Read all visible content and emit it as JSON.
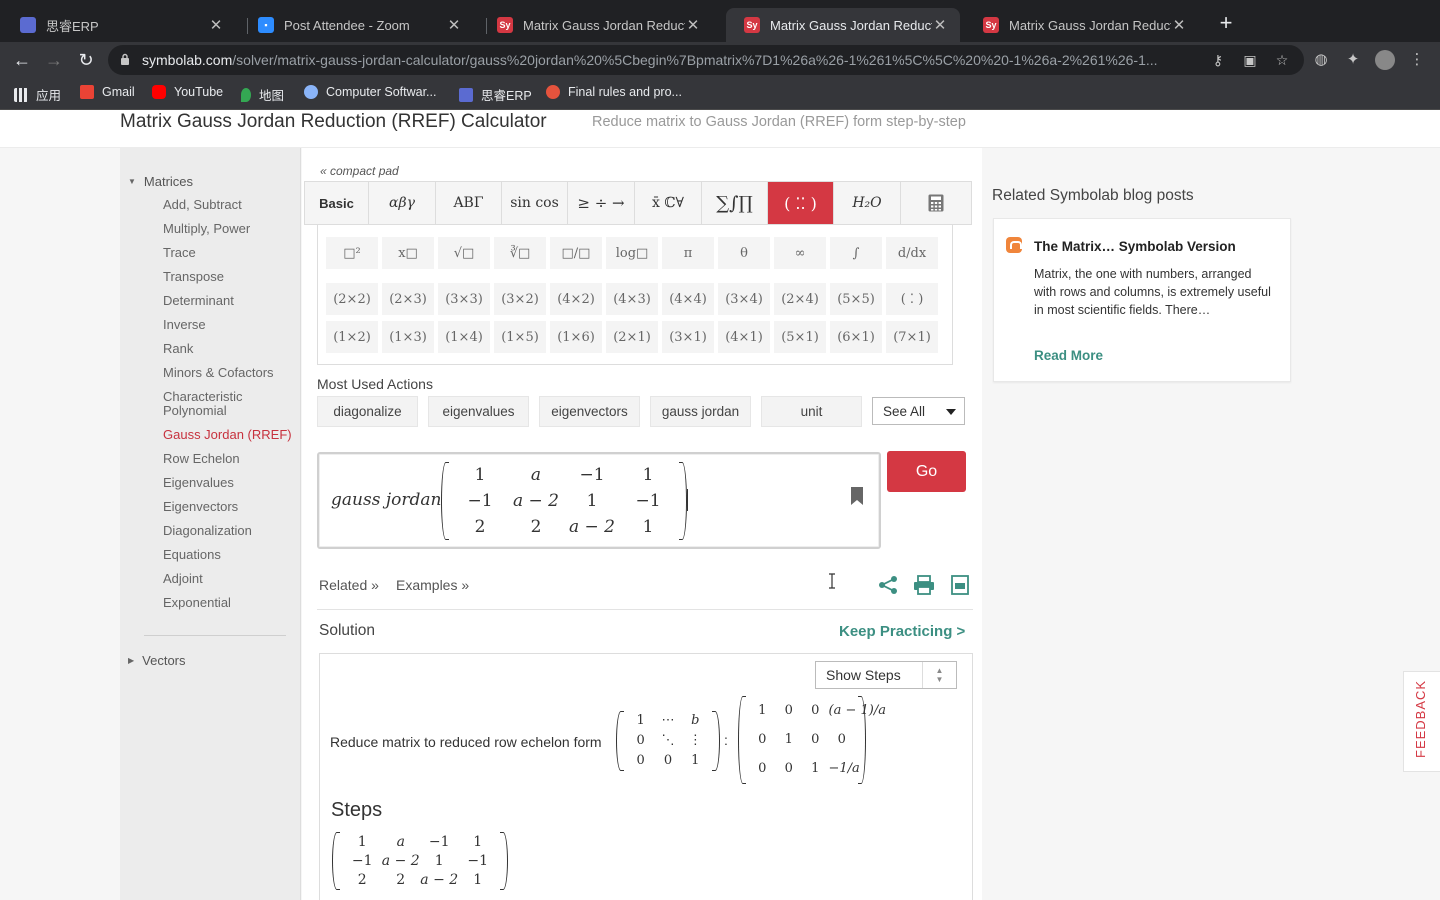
{
  "browser": {
    "tabs": [
      {
        "title": "思睿ERP",
        "favicon_color": "#5b6bd1"
      },
      {
        "title": "Post Attendee - Zoom",
        "favicon_color": "#2d8cff"
      },
      {
        "title": "Matrix Gauss Jordan Reduction",
        "favicon_color": "#d43843",
        "favicon_text": "Sy"
      },
      {
        "title": "Matrix Gauss Jordan Reduction",
        "favicon_color": "#d43843",
        "favicon_text": "Sy"
      },
      {
        "title": "Matrix Gauss Jordan Reduction",
        "favicon_color": "#d43843",
        "favicon_text": "Sy"
      }
    ],
    "active_tab_index": 3,
    "url_host": "symbolab.com",
    "url_path": "/solver/matrix-gauss-jordan-calculator/gauss%20jordan%20%5Cbegin%7Bpmatrix%7D1%26a%26-1%261%5C%5C%20%20-1%26a-2%261%26-1...",
    "bookmarks": [
      {
        "label": "应用",
        "icon_color": "#e8eaed"
      },
      {
        "label": "Gmail",
        "icon_color": "#ea4335"
      },
      {
        "label": "YouTube",
        "icon_color": "#ff0000"
      },
      {
        "label": "地图",
        "icon_color": "#34a853"
      },
      {
        "label": "Computer Softwar...",
        "icon_color": "#8ab4f8"
      },
      {
        "label": "思睿ERP",
        "icon_color": "#5b6bd1"
      },
      {
        "label": "Final rules and pro...",
        "icon_color": "#e5533d"
      }
    ]
  },
  "header": {
    "title": "Matrix Gauss Jordan Reduction (RREF) Calculator",
    "subtitle": "Reduce matrix to Gauss Jordan (RREF) form step-by-step"
  },
  "sidebar": {
    "section_matrices": "Matrices",
    "items": [
      "Add, Subtract",
      "Multiply, Power",
      "Trace",
      "Transpose",
      "Determinant",
      "Inverse",
      "Rank",
      "Minors & Cofactors",
      "Characteristic Polynomial",
      "Gauss Jordan (RREF)",
      "Row Echelon",
      "Eigenvalues",
      "Eigenvectors",
      "Diagonalization",
      "Equations",
      "Adjoint",
      "Exponential"
    ],
    "active_item": "Gauss Jordan (RREF)",
    "section_vectors": "Vectors"
  },
  "keypad": {
    "compact_pad": "« compact pad",
    "tabs": [
      "Basic",
      "αβγ",
      "ABΓ",
      "sin cos",
      "≥ ÷ →",
      "x̄ ℂ∀",
      "∑∫∏",
      "( ⁚⁚ )",
      "H₂O",
      "calculator-icon"
    ],
    "active_tab": 7,
    "row1": [
      "□²",
      "x□",
      "√□",
      "∛□",
      "□/□",
      "log□",
      "π",
      "θ",
      "∞",
      "∫",
      "d/dx"
    ],
    "row2": [
      "(2×2)",
      "(2×3)",
      "(3×3)",
      "(3×2)",
      "(4×2)",
      "(4×3)",
      "(4×4)",
      "(3×4)",
      "(2×4)",
      "(5×5)",
      "( ⁚ )"
    ],
    "row3": [
      "(1×2)",
      "(1×3)",
      "(1×4)",
      "(1×5)",
      "(1×6)",
      "(2×1)",
      "(3×1)",
      "(4×1)",
      "(5×1)",
      "(6×1)",
      "(7×1)"
    ]
  },
  "actions": {
    "label": "Most Used Actions",
    "chips": [
      "diagonalize",
      "eigenvalues",
      "eigenvectors",
      "gauss jordan",
      "unit"
    ],
    "see_all": "See All"
  },
  "input": {
    "prefix": "gauss jordan",
    "matrix": [
      [
        "1",
        "a",
        "−1",
        "1"
      ],
      [
        "−1",
        "a − 2",
        "1",
        "−1"
      ],
      [
        "2",
        "2",
        "a − 2",
        "1"
      ]
    ],
    "go": "Go"
  },
  "links": {
    "related": "Related »",
    "examples": "Examples »"
  },
  "solution": {
    "label": "Solution",
    "keep_practicing": "Keep Practicing >",
    "show_steps": "Show Steps",
    "reduce_text": "Reduce matrix to reduced row echelon form",
    "rref_template": [
      [
        "1",
        "⋯",
        "b"
      ],
      [
        "0",
        "⋱",
        "⋮"
      ],
      [
        "0",
        "0",
        "1"
      ]
    ],
    "result": [
      [
        "1",
        "0",
        "0",
        "(a − 1)/a"
      ],
      [
        "0",
        "1",
        "0",
        "0"
      ],
      [
        "0",
        "0",
        "1",
        "−1/a"
      ]
    ],
    "steps_heading": "Steps",
    "steps_matrix": [
      [
        "1",
        "a",
        "−1",
        "1"
      ],
      [
        "−1",
        "a − 2",
        "1",
        "−1"
      ],
      [
        "2",
        "2",
        "a − 2",
        "1"
      ]
    ]
  },
  "blog": {
    "heading": "Related Symbolab blog posts",
    "title": "The Matrix… Symbolab Version",
    "text": "Matrix, the one with numbers, arranged with rows and columns, is extremely useful in most scientific fields. There…",
    "read_more": "Read More"
  },
  "feedback": "FEEDBACK",
  "colors": {
    "brand_red": "#d43843",
    "teal": "#3c8f82",
    "active_sidebar": "#c7323e"
  }
}
